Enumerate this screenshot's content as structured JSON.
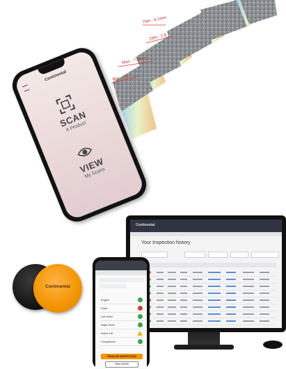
{
  "scan_annotations": [
    "75th - 6.1mm",
    "25th - 2.8",
    "Max - 7.6mm",
    "Min - 3.1"
  ],
  "phone_app": {
    "brand": "Continental",
    "scan_title": "SCAN",
    "scan_subtitle": "A Product",
    "view_title": "VIEW",
    "view_subtitle": "My Scans"
  },
  "puck": {
    "brand": "Continental"
  },
  "desktop": {
    "header_brand": "Continental",
    "page_title": "Your Inspection history",
    "rows": 8,
    "status_colors": [
      "#d9534f",
      "#5cb85c",
      "#5cb85c",
      "#5cb85c",
      "#d9534f",
      "#5cb85c",
      "#5cb85c",
      "#5cb85c"
    ]
  },
  "mobile_report": {
    "items": [
      {
        "label": "Engine",
        "status": "ok"
      },
      {
        "label": "Drain",
        "status": "bad"
      },
      {
        "label": "Left Shell",
        "status": "ok"
      },
      {
        "label": "Right Shell",
        "status": "ok"
      },
      {
        "label": "Inside Lift",
        "status": "warn"
      },
      {
        "label": "Compliance",
        "status": "ok"
      }
    ],
    "primary_button": "FINALIZE INSPECTION",
    "secondary_button": "VIEW MORE"
  },
  "colors": {
    "ok": "#3da34a",
    "bad": "#d9382f",
    "warn": "#e9b51c",
    "accent": "#f29400"
  }
}
